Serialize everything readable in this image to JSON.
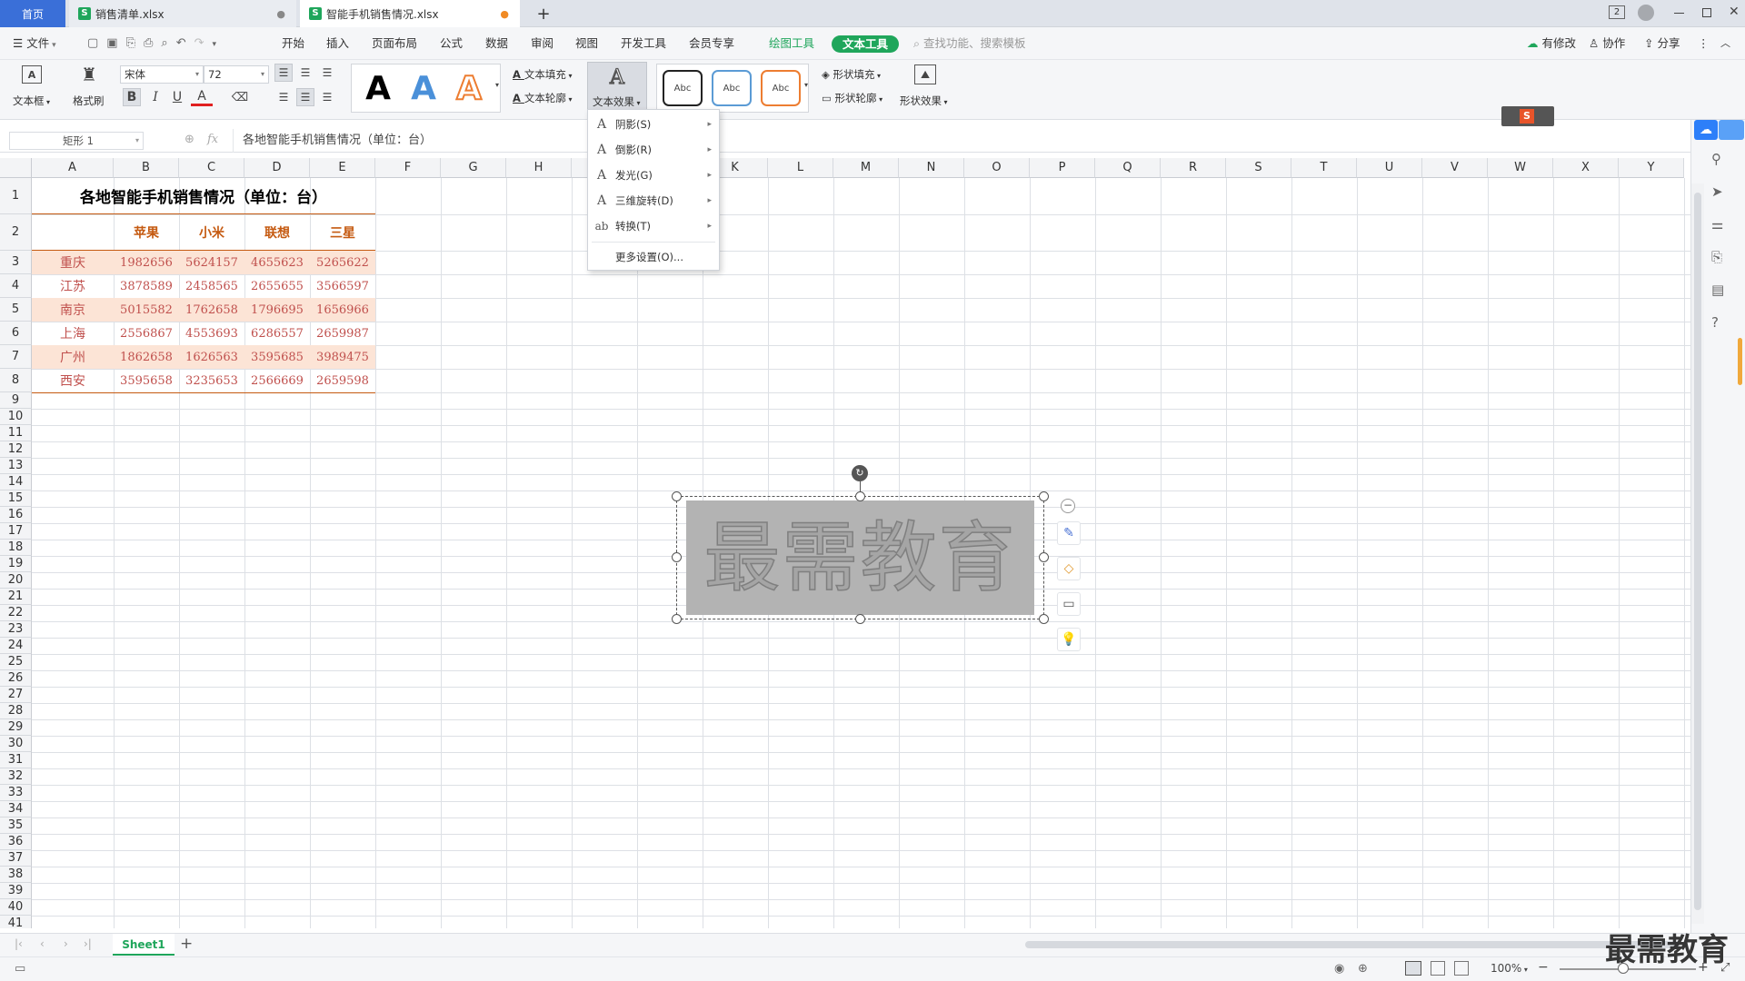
{
  "tabs": {
    "home": "首页",
    "file1": "销售清单.xlsx",
    "file2": "智能手机销售情况.xlsx",
    "new_tab": "+"
  },
  "window_controls": {
    "tab_count": "2"
  },
  "menu": {
    "file": "文件",
    "items": [
      "开始",
      "插入",
      "页面布局",
      "公式",
      "数据",
      "审阅",
      "视图",
      "开发工具",
      "会员专享"
    ],
    "drawing_tools": "绘图工具",
    "text_tools": "文本工具",
    "search_placeholder": "查找功能、搜索模板",
    "has_changes": "有修改",
    "collaborate": "协作",
    "share": "分享"
  },
  "ribbon": {
    "textbox": "文本框",
    "format_painter": "格式刷",
    "font_name": "宋体",
    "font_size": "72",
    "text_fill": "文本填充",
    "text_outline": "文本轮廓",
    "text_effect": "文本效果",
    "shape_style_label": "Abc",
    "shape_fill": "形状填充",
    "shape_outline": "形状轮廓",
    "shape_effect": "形状效果",
    "bold": "B",
    "italic": "I",
    "underline": "U",
    "font_color_glyph": "A"
  },
  "formula_bar": {
    "name_box": "矩形 1",
    "fx": "fx",
    "content": "各地智能手机销售情况（单位：台）"
  },
  "text_effect_menu": {
    "items": [
      {
        "label": "阴影(S)",
        "icon": "A"
      },
      {
        "label": "倒影(R)",
        "icon": "A"
      },
      {
        "label": "发光(G)",
        "icon": "A"
      },
      {
        "label": "三维旋转(D)",
        "icon": "A"
      },
      {
        "label": "转换(T)",
        "icon": "ab"
      }
    ],
    "more": "更多设置(O)..."
  },
  "columns": [
    "A",
    "B",
    "C",
    "D",
    "E",
    "F",
    "G",
    "H",
    "I",
    "J",
    "K",
    "L",
    "M",
    "N",
    "O",
    "P",
    "Q",
    "R",
    "S",
    "T",
    "U",
    "V",
    "W",
    "X",
    "Y"
  ],
  "rows": [
    "1",
    "2",
    "3",
    "4",
    "5",
    "6",
    "7",
    "8",
    "9",
    "10",
    "11",
    "12",
    "13",
    "14",
    "15",
    "16",
    "17",
    "18",
    "19",
    "20",
    "21",
    "22",
    "23",
    "24",
    "25",
    "26",
    "27",
    "28",
    "29",
    "30",
    "31",
    "32",
    "33",
    "34",
    "35",
    "36",
    "37",
    "38",
    "39",
    "40",
    "41"
  ],
  "sheet": {
    "title": "各地智能手机销售情况（单位：台）",
    "brands": [
      "苹果",
      "小米",
      "联想",
      "三星"
    ],
    "data": [
      {
        "city": "重庆",
        "values": [
          "1982656",
          "5624157",
          "4655623",
          "5265622"
        ]
      },
      {
        "city": "江苏",
        "values": [
          "3878589",
          "2458565",
          "2655655",
          "3566597"
        ]
      },
      {
        "city": "南京",
        "values": [
          "5015582",
          "1762658",
          "1796695",
          "1656966"
        ]
      },
      {
        "city": "上海",
        "values": [
          "2556867",
          "4553693",
          "6286557",
          "2659987"
        ]
      },
      {
        "city": "广州",
        "values": [
          "1862658",
          "1626563",
          "3595685",
          "3989475"
        ]
      },
      {
        "city": "西安",
        "values": [
          "3595658",
          "3235653",
          "2566669",
          "2659598"
        ]
      }
    ]
  },
  "wordart": {
    "text": "最需教育"
  },
  "sheet_tabs": {
    "active": "Sheet1",
    "add": "+"
  },
  "status": {
    "zoom": "100%"
  },
  "watermark": "最需教育",
  "colors": {
    "accent_green": "#1fa65b",
    "header_orange": "#c55a11",
    "number_red": "#c0504d",
    "band_fill": "#fce4d6"
  }
}
